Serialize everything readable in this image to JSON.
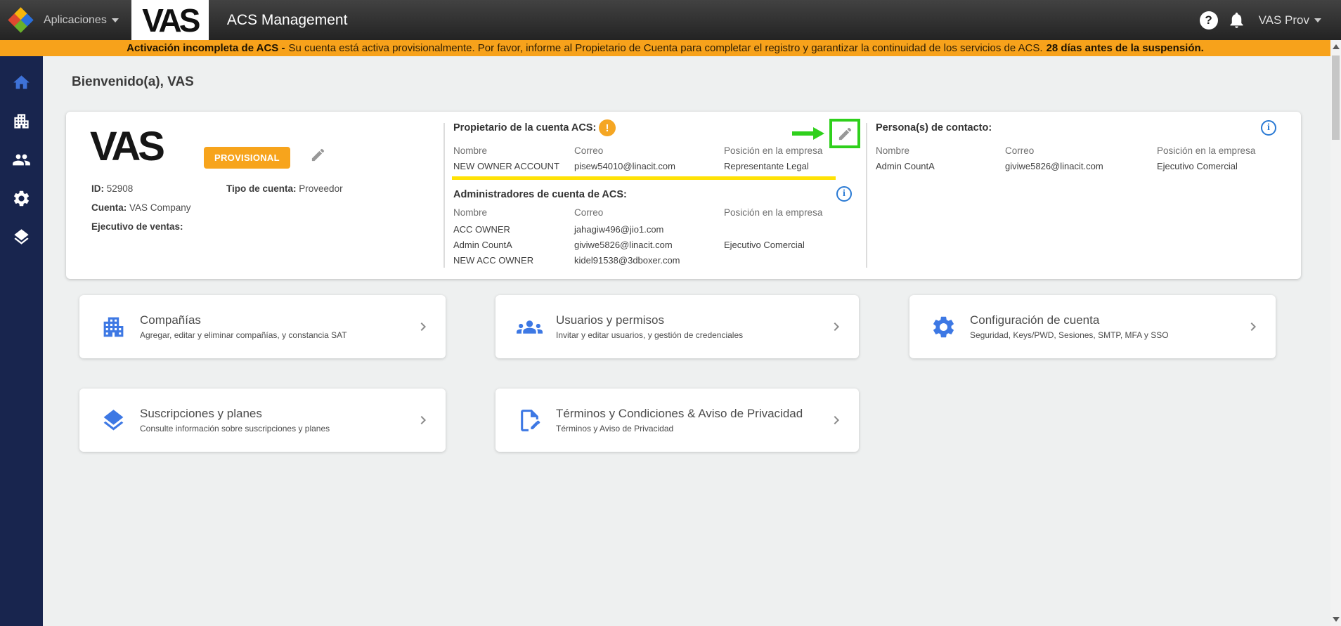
{
  "topbar": {
    "apps_menu": "Aplicaciones",
    "brand": "VAS",
    "title": "ACS Management",
    "help": "?",
    "user_menu": "VAS Prov"
  },
  "banner": {
    "bold_lead": "Activación incompleta de ACS -",
    "body": "Su cuenta está activa provisionalmente. Por favor, informe al Propietario de Cuenta para completar el registro y garantizar la continuidad de los servicios de ACS.",
    "bold_tail": "28 días antes de la suspensión."
  },
  "sidebar": {
    "items": [
      {
        "icon": "home-icon",
        "active": true
      },
      {
        "icon": "building-icon",
        "active": false
      },
      {
        "icon": "users-icon",
        "active": false
      },
      {
        "icon": "gear-icon",
        "active": false
      },
      {
        "icon": "layers-icon",
        "active": false
      }
    ]
  },
  "welcome": "Bienvenido(a), VAS",
  "account": {
    "logo": "VAS",
    "badge": "PROVISIONAL",
    "id_label": "ID:",
    "id_value": "52908",
    "type_label": "Tipo de cuenta:",
    "type_value": "Proveedor",
    "name_label": "Cuenta:",
    "name_value": "VAS Company",
    "sales_label": "Ejecutivo de ventas:",
    "sales_value": ""
  },
  "owner": {
    "title": "Propietario de la cuenta ACS:",
    "col_name": "Nombre",
    "col_email": "Correo",
    "col_position": "Posición en la empresa",
    "rows": [
      {
        "name": "NEW OWNER ACCOUNT",
        "email": "pisew54010@linacit.com",
        "position": "Representante Legal"
      }
    ]
  },
  "admins": {
    "title": "Administradores de cuenta de ACS:",
    "col_name": "Nombre",
    "col_email": "Correo",
    "col_position": "Posición en la empresa",
    "rows": [
      {
        "name": "ACC OWNER",
        "email": "jahagiw496@jio1.com",
        "position": ""
      },
      {
        "name": "Admin CountA",
        "email": "giviwe5826@linacit.com",
        "position": "Ejecutivo Comercial"
      },
      {
        "name": "NEW ACC OWNER",
        "email": "kidel91538@3dboxer.com",
        "position": ""
      }
    ]
  },
  "contacts": {
    "title": "Persona(s) de contacto:",
    "col_name": "Nombre",
    "col_email": "Correo",
    "col_position": "Posición en la empresa",
    "rows": [
      {
        "name": "Admin CountA",
        "email": "giviwe5826@linacit.com",
        "position": "Ejecutivo Comercial"
      }
    ]
  },
  "nav_cards": [
    {
      "icon": "building-icon",
      "title": "Compañías",
      "subtitle": "Agregar, editar y eliminar compañías, y constancia SAT"
    },
    {
      "icon": "users-icon",
      "title": "Usuarios y permisos",
      "subtitle": "Invitar y editar usuarios, y gestión de credenciales"
    },
    {
      "icon": "gear-icon",
      "title": "Configuración de cuenta",
      "subtitle": "Seguridad, Keys/PWD, Sesiones, SMTP, MFA y SSO"
    },
    {
      "icon": "layers-icon",
      "title": "Suscripciones y planes",
      "subtitle": "Consulte información sobre suscripciones y planes"
    },
    {
      "icon": "document-edit-icon",
      "title": "Términos y Condiciones & Aviso de Privacidad",
      "subtitle": "Términos y Aviso de Privacidad"
    }
  ],
  "colors": {
    "banner_bg": "#f7a21b",
    "badge_bg": "#f7a41c",
    "accent_blue": "#3d78e4",
    "sidebar_bg": "#18254e",
    "highlight_yellow": "#ffe205",
    "annotation_green": "#2fd01c",
    "info_blue": "#2a7ad4",
    "warning_orange": "#f5a623"
  }
}
